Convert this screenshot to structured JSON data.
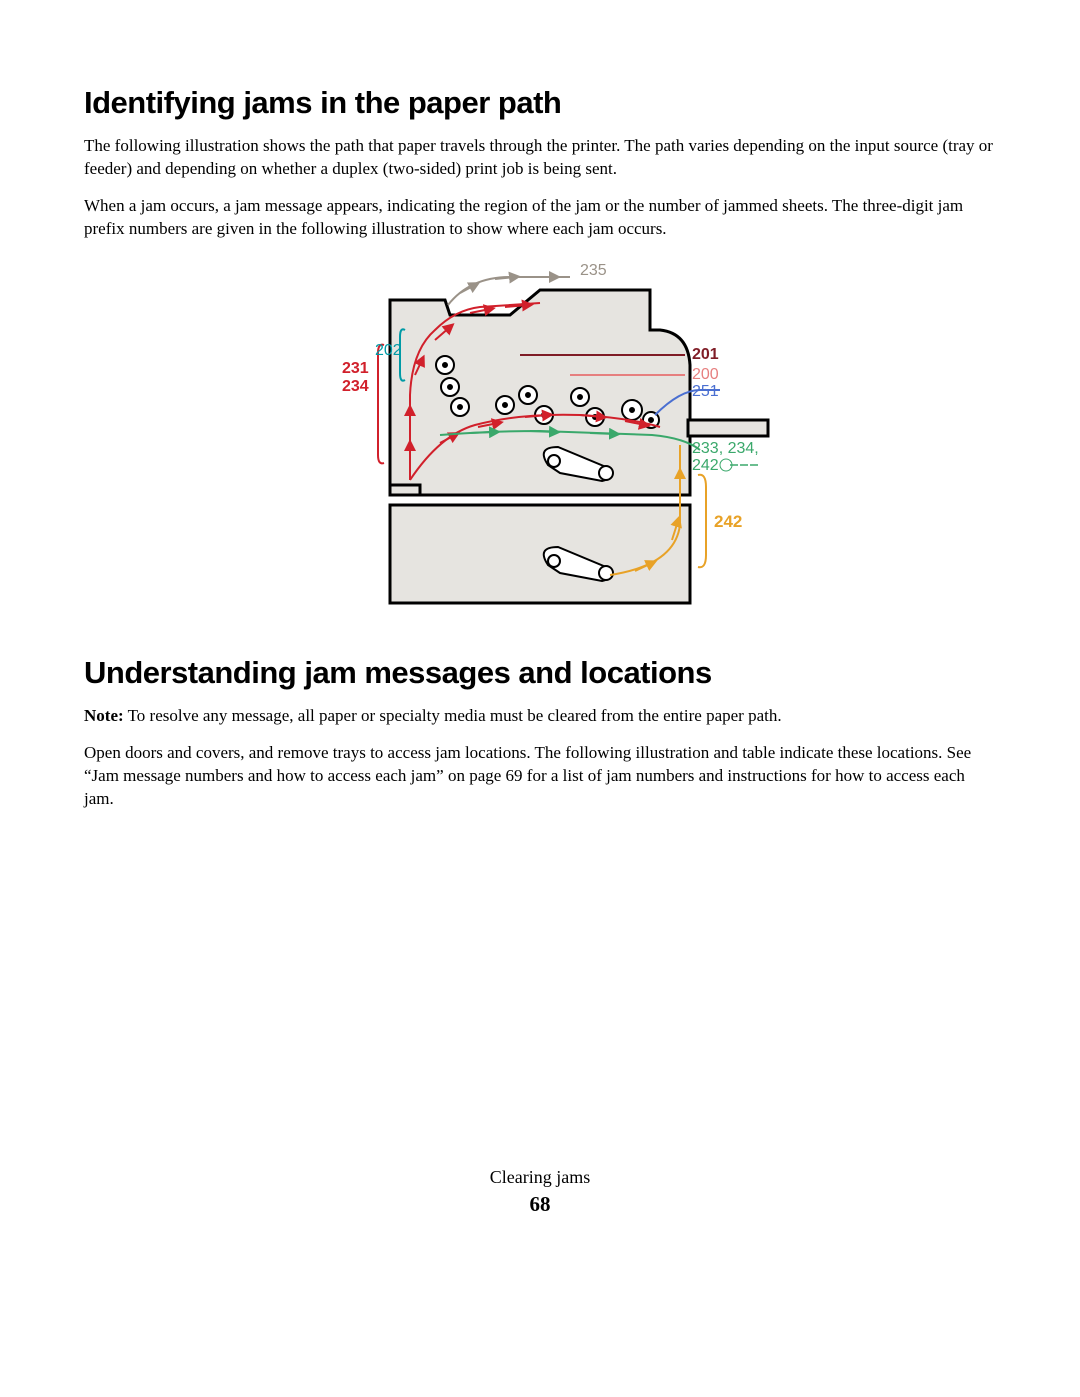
{
  "section1": {
    "heading": "Identifying jams in the paper path",
    "para1": "The following illustration shows the path that paper travels through the printer. The path varies depending on the input source (tray or feeder) and depending on whether a duplex (two-sided) print job is being sent.",
    "para2": "When a jam occurs, a jam message appears, indicating the region of the jam or the number of jammed sheets. The three-digit jam prefix numbers are given in the following illustration to show where each jam occurs."
  },
  "section2": {
    "heading": "Understanding jam messages and locations",
    "note_label": "Note:",
    "note_text": " To resolve any message, all paper or specialty media must be cleared from the entire paper path.",
    "para2": "Open doors and covers, and remove trays to access jam locations. The following illustration and table indicate these locations. See “Jam message numbers and how to access each jam” on page 69 for a list of jam numbers and instructions for how to access each jam."
  },
  "diagram": {
    "label_235": "235",
    "label_202": "202",
    "label_231": "231",
    "label_234": "234",
    "label_201": "201",
    "label_200": "200",
    "label_251": "251",
    "label_233_234": "233, 234,",
    "label_242_top": "242",
    "label_242": "242",
    "colors": {
      "red": "#d1202b",
      "teal": "#009aa6",
      "maroon": "#7f1c26",
      "salmon": "#e67f7f",
      "blue": "#4a6fd1",
      "green": "#3aa86b",
      "orange": "#e8a227",
      "gray": "#9a9288"
    }
  },
  "footer": {
    "chapter": "Clearing jams",
    "page": "68"
  }
}
